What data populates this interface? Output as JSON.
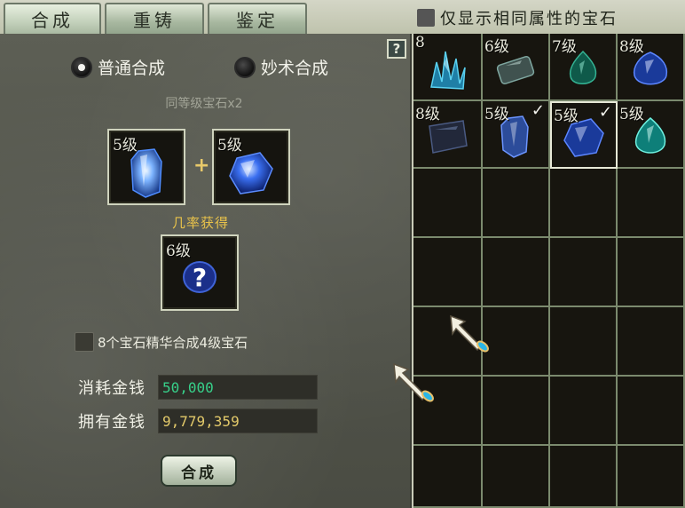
{
  "tabs": [
    {
      "label": "合成",
      "active": true
    },
    {
      "label": "重铸",
      "active": false
    },
    {
      "label": "鉴定",
      "active": false
    }
  ],
  "filter": {
    "label": "仅显示相同属性的宝石",
    "checked": false
  },
  "help": {
    "label": "?"
  },
  "modes": [
    {
      "label": "普通合成",
      "selected": true
    },
    {
      "label": "妙术合成",
      "selected": false
    }
  ],
  "requirement": "同等级宝石x2",
  "inputs": [
    {
      "level": "5级",
      "gem": "blue-crystal"
    },
    {
      "level": "5级",
      "gem": "blue-sapphire"
    }
  ],
  "plus": "+",
  "result": {
    "label": "几率获得",
    "level": "6级",
    "mark": "?"
  },
  "essence_option": {
    "label": "8个宝石精华合成4级宝石",
    "checked": false
  },
  "cost": {
    "label": "消耗金钱",
    "value": "50,000"
  },
  "owned": {
    "label": "拥有金钱",
    "value": "9,779,359"
  },
  "combine_button": "合成",
  "inventory": [
    {
      "level": "8",
      "gem": "teal-cluster",
      "checked": false
    },
    {
      "level": "6级",
      "gem": "slate-bar",
      "checked": false
    },
    {
      "level": "7级",
      "gem": "green-drop",
      "checked": false
    },
    {
      "level": "8级",
      "gem": "blue-drop",
      "checked": false
    },
    {
      "level": "8级",
      "gem": "dark-block",
      "checked": false
    },
    {
      "level": "5级",
      "gem": "blue-crystal",
      "checked": true
    },
    {
      "level": "5级",
      "gem": "blue-sapphire",
      "checked": true,
      "selected": true
    },
    {
      "level": "5级",
      "gem": "aqua-drop",
      "checked": false
    }
  ],
  "colors": {
    "money_cost": "#37d08a",
    "money_owned": "#e2c96a",
    "probability_label": "#e8c24a"
  }
}
